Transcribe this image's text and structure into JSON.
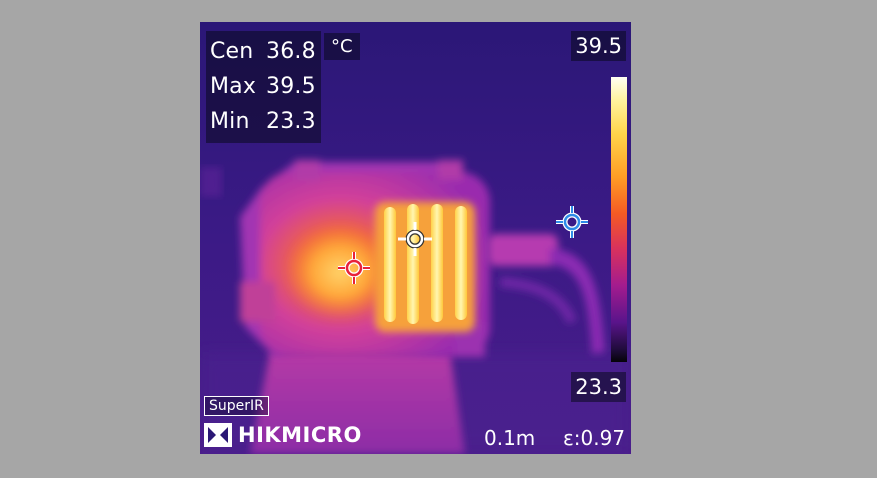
{
  "readout": {
    "center_label": "Cen",
    "center_value": "36.8",
    "max_label": "Max",
    "max_value": "39.5",
    "min_label": "Min",
    "min_value": "23.3",
    "unit": "°C"
  },
  "scale": {
    "max": "39.5",
    "min": "23.3"
  },
  "badge": "SuperIR",
  "brand": "HIKMICRO",
  "distance": "0.1m",
  "emissivity": "ε:0.97",
  "markers": {
    "hot_color": "#e8223a",
    "center_color": "#ffffff",
    "cold_color": "#2f8ce8"
  },
  "icons": [
    "hot-spot-crosshair-icon",
    "center-crosshair-icon",
    "cold-spot-crosshair-icon",
    "hikmicro-logo-icon"
  ]
}
